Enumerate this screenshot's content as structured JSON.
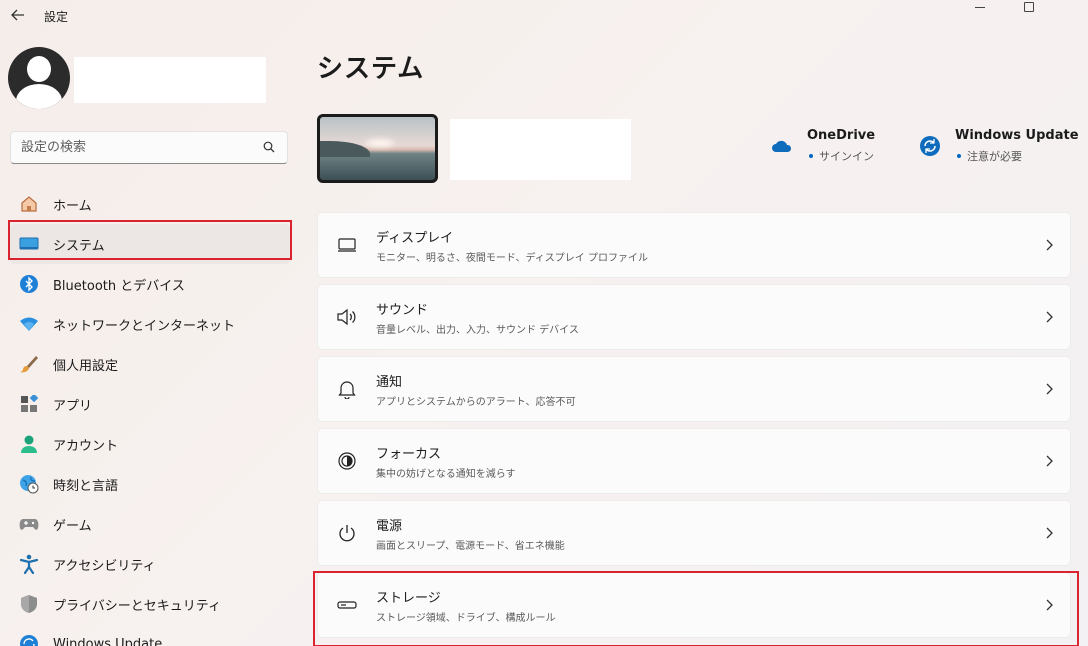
{
  "app": {
    "title": "設定"
  },
  "search": {
    "placeholder": "設定の検索"
  },
  "sidebar": {
    "items": [
      {
        "label": "ホーム",
        "icon": "home-icon"
      },
      {
        "label": "システム",
        "icon": "monitor-icon",
        "selected": true
      },
      {
        "label": "Bluetooth とデバイス",
        "icon": "bluetooth-icon"
      },
      {
        "label": "ネットワークとインターネット",
        "icon": "wifi-icon"
      },
      {
        "label": "個人用設定",
        "icon": "brush-icon"
      },
      {
        "label": "アプリ",
        "icon": "apps-icon"
      },
      {
        "label": "アカウント",
        "icon": "person-icon"
      },
      {
        "label": "時刻と言語",
        "icon": "globe-clock-icon"
      },
      {
        "label": "ゲーム",
        "icon": "gamepad-icon"
      },
      {
        "label": "アクセシビリティ",
        "icon": "accessibility-icon"
      },
      {
        "label": "プライバシーとセキュリティ",
        "icon": "shield-icon"
      },
      {
        "label": "Windows Update",
        "icon": "update-icon"
      }
    ]
  },
  "main": {
    "title": "システム",
    "quick": {
      "onedrive": {
        "title": "OneDrive",
        "status": "サインイン",
        "icon": "cloud-icon",
        "color": "#0f6cbd"
      },
      "windows_update": {
        "title": "Windows Update",
        "status": "注意が必要",
        "icon": "sync-icon",
        "color": "#0f6cbd"
      }
    },
    "cards": [
      {
        "title": "ディスプレイ",
        "subtitle": "モニター、明るさ、夜間モード、ディスプレイ プロファイル",
        "icon": "display-icon"
      },
      {
        "title": "サウンド",
        "subtitle": "音量レベル、出力、入力、サウンド デバイス",
        "icon": "speaker-icon"
      },
      {
        "title": "通知",
        "subtitle": "アプリとシステムからのアラート、応答不可",
        "icon": "bell-icon"
      },
      {
        "title": "フォーカス",
        "subtitle": "集中の妨げとなる通知を減らす",
        "icon": "focus-icon"
      },
      {
        "title": "電源",
        "subtitle": "画面とスリープ、電源モード、省エネ機能",
        "icon": "power-icon"
      },
      {
        "title": "ストレージ",
        "subtitle": "ストレージ領域、ドライブ、構成ルール",
        "icon": "storage-icon",
        "highlighted": true
      }
    ]
  },
  "colors": {
    "accent": "#0067c0",
    "highlight_box": "#d9232e"
  }
}
